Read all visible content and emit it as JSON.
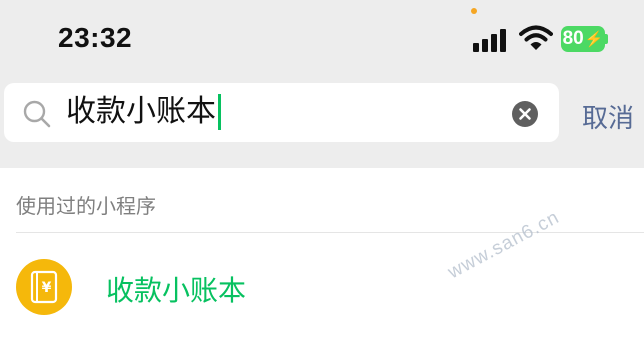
{
  "status_bar": {
    "time": "23:32",
    "battery_level": "80",
    "battery_icon": "charging-bolt-icon"
  },
  "search": {
    "query": "收款小账本",
    "cancel_label": "取消",
    "caret_color": "#07c160"
  },
  "section": {
    "header": "使用过的小程序"
  },
  "results": [
    {
      "name": "收款小账本",
      "icon": "ledger-yuan-icon",
      "icon_bg": "#f5b80b",
      "name_color": "#07c160"
    }
  ],
  "watermark": "www.san6.cn"
}
